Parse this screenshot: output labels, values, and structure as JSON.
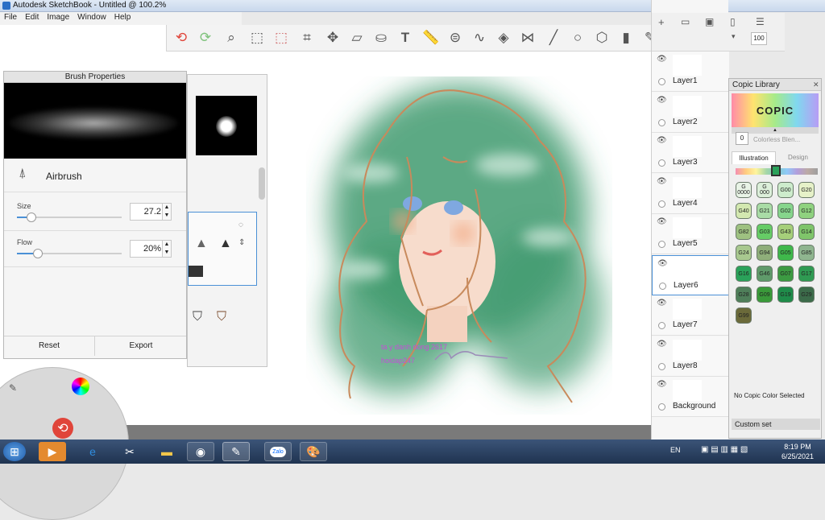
{
  "window": {
    "title": "Autodesk SketchBook - Untitled @ 100.2%"
  },
  "menu": [
    "File",
    "Edit",
    "Image",
    "Window",
    "Help"
  ],
  "brush_properties": {
    "title": "Brush Properties",
    "brush_name": "Airbrush",
    "size_label": "Size",
    "size_value": "27.2",
    "size_fraction": 0.14,
    "flow_label": "Flow",
    "flow_value": "20%",
    "flow_fraction": 0.2,
    "reset_label": "Reset",
    "export_label": "Export"
  },
  "layer_panel": {
    "opacity_value": "100",
    "layers": [
      {
        "name": "Layer1",
        "visible": true,
        "active": false
      },
      {
        "name": "Layer2",
        "visible": true,
        "active": false
      },
      {
        "name": "Layer3",
        "visible": true,
        "active": false
      },
      {
        "name": "Layer4",
        "visible": true,
        "active": false
      },
      {
        "name": "Layer5",
        "visible": true,
        "active": false
      },
      {
        "name": "Layer6",
        "visible": true,
        "active": true
      },
      {
        "name": "Layer7",
        "visible": true,
        "active": false
      },
      {
        "name": "Layer8",
        "visible": true,
        "active": false
      },
      {
        "name": "Background",
        "visible": true,
        "active": false
      }
    ]
  },
  "copic": {
    "title": "Copic Library",
    "logo": "COPIC",
    "blender": "Colorless Blen...",
    "blender_code": "0",
    "tabs": [
      "Illustration",
      "Design"
    ],
    "chips": [
      {
        "code": "G\n0000",
        "color": "#e8f3e6"
      },
      {
        "code": "G\n000",
        "color": "#dcefda"
      },
      {
        "code": "G00",
        "color": "#cdeccc"
      },
      {
        "code": "G20",
        "color": "#e6f1c8"
      },
      {
        "code": "G40",
        "color": "#d3e8b0"
      },
      {
        "code": "G21",
        "color": "#a9dca6"
      },
      {
        "code": "G02",
        "color": "#86d58c"
      },
      {
        "code": "G12",
        "color": "#8fd27f"
      },
      {
        "code": "G82",
        "color": "#9ec181"
      },
      {
        "code": "G03",
        "color": "#66cc66"
      },
      {
        "code": "G43",
        "color": "#a6cf7a"
      },
      {
        "code": "G14",
        "color": "#7fc56a"
      },
      {
        "code": "G24",
        "color": "#a8c88f"
      },
      {
        "code": "G94",
        "color": "#8fae7a"
      },
      {
        "code": "G05",
        "color": "#3fb84b"
      },
      {
        "code": "G85",
        "color": "#8fb58f"
      },
      {
        "code": "G16",
        "color": "#2aa25a"
      },
      {
        "code": "G46",
        "color": "#5f9a6a"
      },
      {
        "code": "G07",
        "color": "#3c9a42"
      },
      {
        "code": "G17",
        "color": "#2f9a52"
      },
      {
        "code": "G28",
        "color": "#4f7f5a"
      },
      {
        "code": "G09",
        "color": "#3a9a3a"
      },
      {
        "code": "G19",
        "color": "#1f8c4a"
      },
      {
        "code": "G29",
        "color": "#3c6b4a"
      },
      {
        "code": "G99",
        "color": "#6b6a3a"
      }
    ],
    "no_selection": "No Copic Color Selected",
    "custom_set": "Custom set"
  },
  "canvas": {
    "text_line1": "ta y danh dong 2617",
    "text_line2": "hoidap247",
    "text_color": "#c44fd6",
    "hair_color": "#3f9a6e",
    "line_color": "#c88a5c"
  },
  "taskbar": {
    "lang": "EN",
    "time": "8:19 PM",
    "date": "6/25/2021",
    "zalo_label": "Zalo"
  }
}
